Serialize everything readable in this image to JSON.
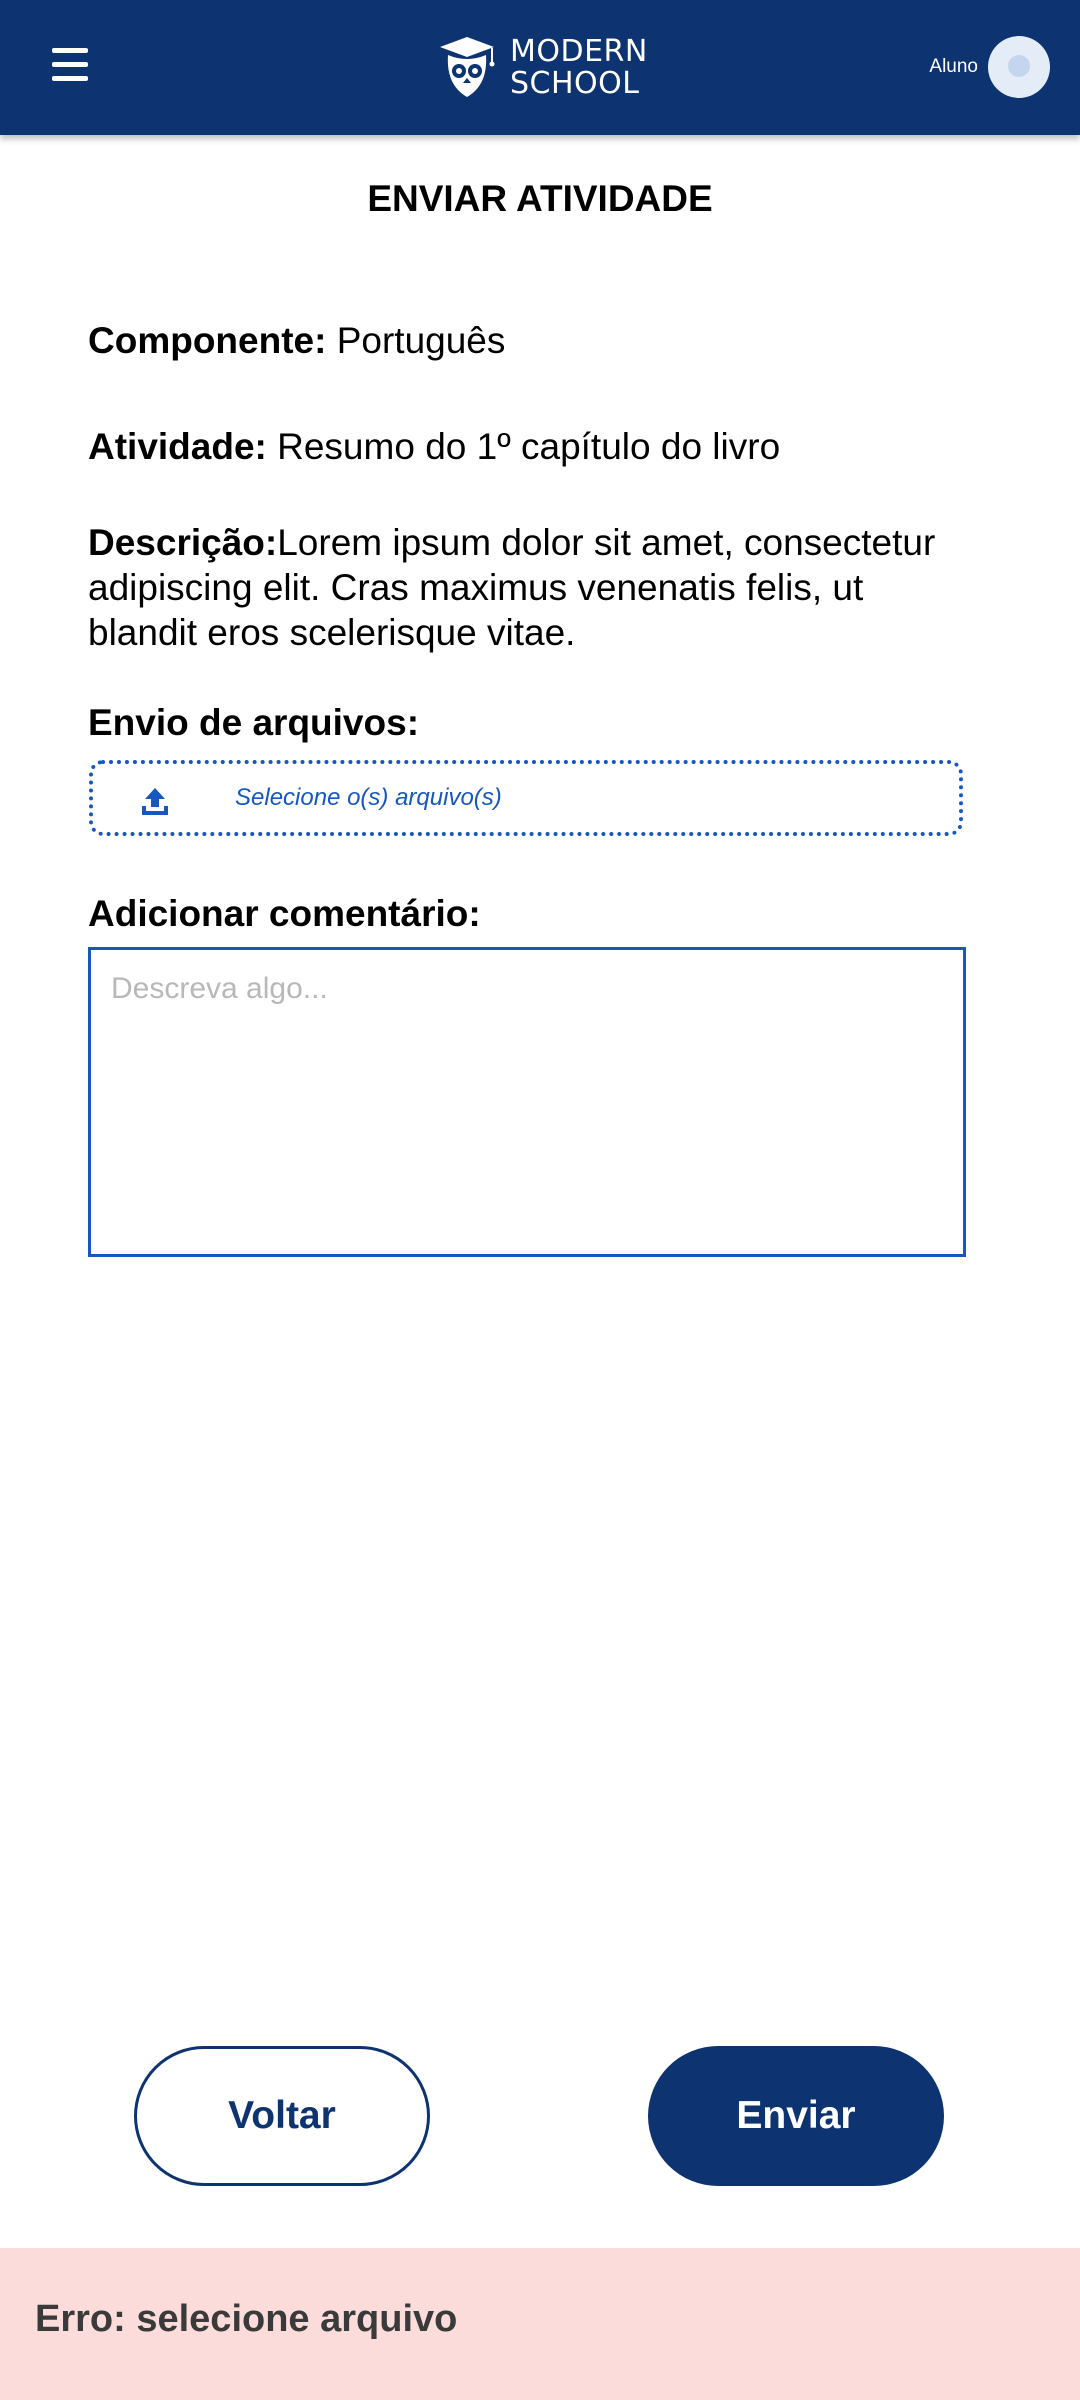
{
  "header": {
    "brand_line1": "MODERN",
    "brand_line2": "SCHOOL",
    "user_role": "Aluno",
    "menu_icon": "hamburger-menu-icon",
    "avatar_icon": "user-avatar-icon",
    "bg_color": "#0d3370"
  },
  "page": {
    "title": "ENVIAR ATIVIDADE"
  },
  "fields": {
    "component_label": "Componente:",
    "component_value": " Português",
    "activity_label": "Atividade:",
    "activity_value": " Resumo do 1º capítulo do livro",
    "description_label": "Descrição:",
    "description_value": "Lorem ipsum dolor sit amet, consectetur adipiscing elit. Cras maximus venenatis felis, ut blandit eros scelerisque vitae."
  },
  "upload": {
    "label": "Envio de arquivos:",
    "button_text": "Selecione o(s) arquivo(s)",
    "icon": "upload-icon",
    "accent_color": "#1657c2"
  },
  "comment": {
    "label": "Adicionar comentário:",
    "placeholder": "Descreva algo...",
    "value": ""
  },
  "actions": {
    "back_label": "Voltar",
    "send_label": "Enviar"
  },
  "error": {
    "message": "Erro: selecione arquivo",
    "bg_color": "#fcdcda"
  }
}
